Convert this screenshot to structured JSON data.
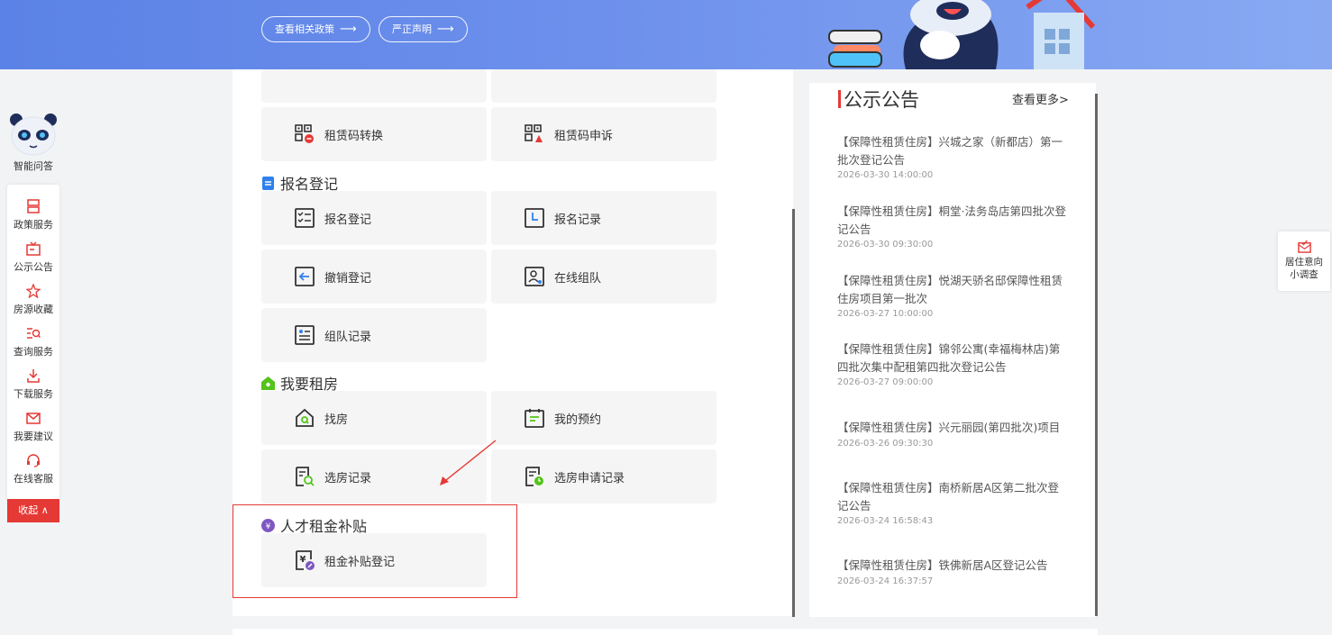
{
  "banner": {
    "btn_policy": "查看相关政策",
    "btn_statement": "严正声明",
    "arrow": "⟶"
  },
  "main": {
    "sections": {
      "baoming": "报名登记",
      "zufang": "我要租房",
      "rencai": "人才租金补贴"
    },
    "tiles": {
      "code_convert": "租赁码转换",
      "code_appeal": "租赁码申诉",
      "register": "报名登记",
      "register_record": "报名记录",
      "cancel_register": "撤销登记",
      "online_team": "在线组队",
      "team_record": "组队记录",
      "find_house": "找房",
      "my_appointment": "我的预约",
      "select_record": "选房记录",
      "select_apply_record": "选房申请记录",
      "subsidy_register": "租金补贴登记"
    }
  },
  "notice": {
    "title": "公示公告",
    "more": "查看更多>",
    "items": [
      {
        "title": "【保障性租赁住房】兴城之家（新都店）第一批次登记公告",
        "date": "2026-03-30 14:00:00"
      },
      {
        "title": "【保障性租赁住房】桐堂·法务岛店第四批次登记公告",
        "date": "2026-03-30 09:30:00"
      },
      {
        "title": "【保障性租赁住房】悦湖天骄名邸保障性租赁住房项目第一批次",
        "date": "2026-03-27 10:00:00"
      },
      {
        "title": "【保障性租赁住房】锦邻公寓(幸福梅林店)第四批次集中配租第四批次登记公告",
        "date": "2026-03-27 09:00:00"
      },
      {
        "title": "【保障性租赁住房】兴元丽园(第四批次)项目",
        "date": "2026-03-26 09:30:30"
      },
      {
        "title": "【保障性租赁住房】南桥新居A区第二批次登记公告",
        "date": "2026-03-24 16:58:43"
      },
      {
        "title": "【保障性租赁住房】铁佛新居A区登记公告",
        "date": "2026-03-24 16:37:57"
      }
    ]
  },
  "sidebar": {
    "robot_label": "智能问答",
    "items": [
      {
        "label": "政策服务",
        "icon": "policy-icon"
      },
      {
        "label": "公示公告",
        "icon": "notice-icon"
      },
      {
        "label": "房源收藏",
        "icon": "star-icon"
      },
      {
        "label": "查询服务",
        "icon": "query-icon"
      },
      {
        "label": "下载服务",
        "icon": "download-icon"
      },
      {
        "label": "我要建议",
        "icon": "mail-icon"
      },
      {
        "label": "在线客服",
        "icon": "headset-icon"
      }
    ],
    "collapse_label": "收起 ∧"
  },
  "survey": {
    "line1": "居住意向",
    "line2": "小调查"
  },
  "colors": {
    "accent_red": "#e53935",
    "banner_blue": "#5b82e6",
    "icon_green": "#52c41a"
  }
}
